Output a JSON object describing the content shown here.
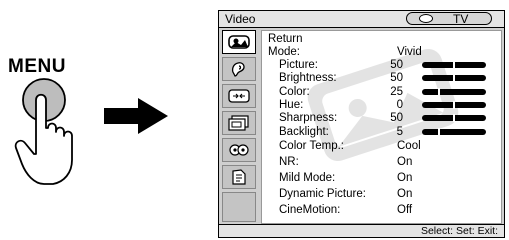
{
  "remote": {
    "menu_label": "MENU"
  },
  "osd": {
    "title": "Video",
    "input": "TV",
    "return_label": "Return",
    "mode": {
      "label": "Mode:",
      "value": "Vivid"
    },
    "settings": [
      {
        "label": "Picture:",
        "value": "50",
        "level": 0.5
      },
      {
        "label": "Brightness:",
        "value": "50",
        "level": 0.5
      },
      {
        "label": "Color:",
        "value": "25",
        "level": 0.25
      },
      {
        "label": "Hue:",
        "value": "0",
        "level": 0.5
      },
      {
        "label": "Sharpness:",
        "value": "50",
        "level": 0.5
      },
      {
        "label": "Backlight:",
        "value": "5",
        "level": 0.25
      }
    ],
    "options": [
      {
        "label": "Color Temp.:",
        "value": "Cool"
      },
      {
        "label": "NR:",
        "value": "On"
      },
      {
        "label": "Mild Mode:",
        "value": "On"
      },
      {
        "label": "Dynamic Picture:",
        "value": "On"
      },
      {
        "label": "CineMotion:",
        "value": "Off"
      }
    ],
    "status": "Select:  Set:  Exit:"
  }
}
